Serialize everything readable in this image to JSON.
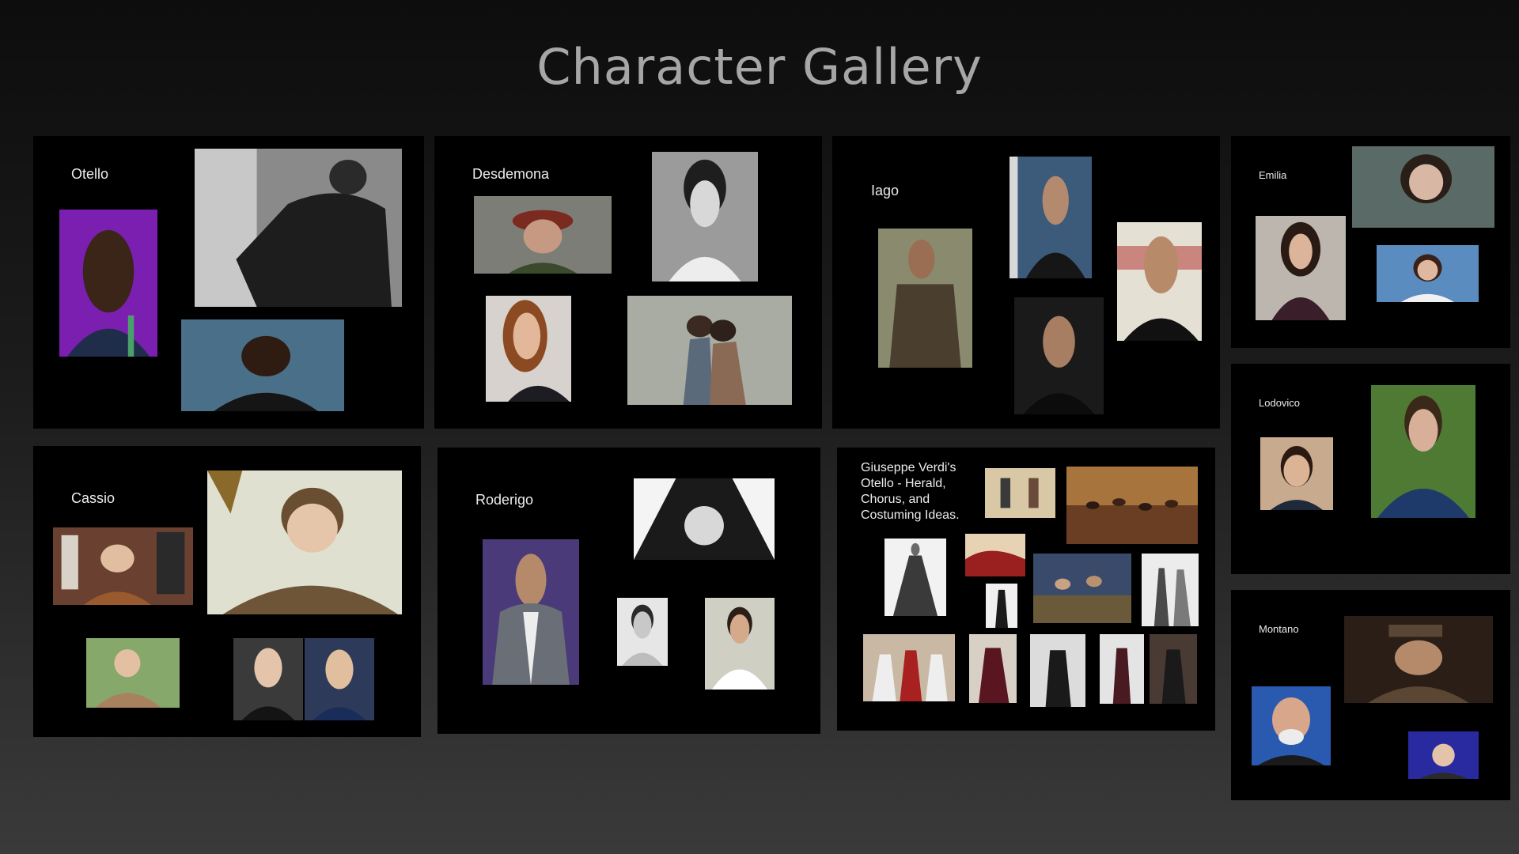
{
  "page": {
    "title": "Character Gallery"
  },
  "boards": {
    "otello": {
      "label": "Otello"
    },
    "desdemona": {
      "label": "Desdemona"
    },
    "iago": {
      "label": "Iago"
    },
    "emilia": {
      "label": "Emilia"
    },
    "cassio": {
      "label": "Cassio"
    },
    "roderigo": {
      "label": "Roderigo"
    },
    "verdi": {
      "label": "Giuseppe Verdi's Otello - Herald, Chorus, and Costuming Ideas."
    },
    "lodovico": {
      "label": "Lodovico"
    },
    "montano": {
      "label": "Montano"
    }
  },
  "colors": {
    "board": "#000000",
    "title": "#a6a6a6",
    "label": "#ececec"
  }
}
